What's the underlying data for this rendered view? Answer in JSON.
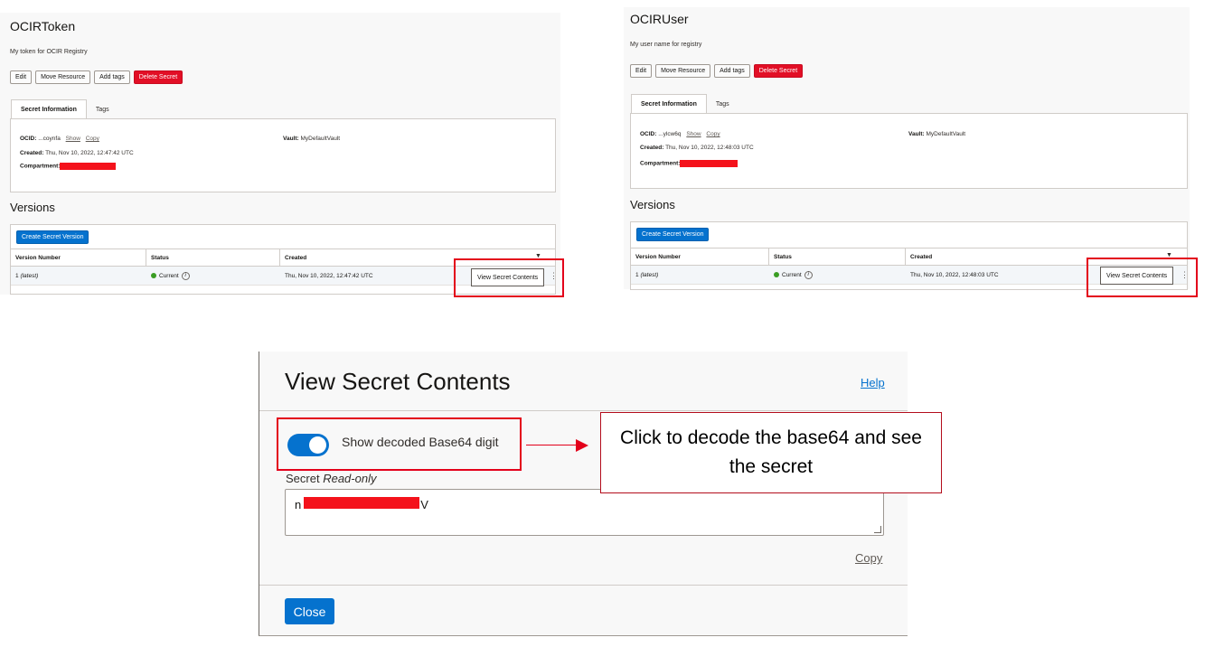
{
  "left_panel": {
    "title": "OCIRToken",
    "description": "My token for OCIR Registry",
    "buttons": {
      "edit": "Edit",
      "move": "Move Resource",
      "tags": "Add tags",
      "delete": "Delete Secret"
    },
    "tabs": {
      "info": "Secret Information",
      "tags": "Tags"
    },
    "ocid_label": "OCID:",
    "ocid_value": "...coynfa",
    "show_link": "Show",
    "copy_link": "Copy",
    "created_label": "Created:",
    "created_value": "Thu, Nov 10, 2022, 12:47:42 UTC",
    "compartment_label": "Compartment:",
    "vault_label": "Vault:",
    "vault_value": "MyDefaultVault",
    "versions_title": "Versions",
    "create_version_button": "Create Secret Version",
    "columns": {
      "version": "Version Number",
      "status": "Status",
      "created": "Created"
    },
    "row": {
      "version_num": "1",
      "version_tag": "(latest)",
      "status": "Current",
      "created": "Thu, Nov 10, 2022, 12:47:42 UTC"
    },
    "view_button": "View Secret Contents"
  },
  "right_panel": {
    "title": "OCIRUser",
    "description": "My user name for registry",
    "buttons": {
      "edit": "Edit",
      "move": "Move Resource",
      "tags": "Add tags",
      "delete": "Delete Secret"
    },
    "tabs": {
      "info": "Secret Information",
      "tags": "Tags"
    },
    "ocid_label": "OCID:",
    "ocid_value": "...ylcw6q",
    "show_link": "Show",
    "copy_link": "Copy",
    "created_label": "Created:",
    "created_value": "Thu, Nov 10, 2022, 12:48:03 UTC",
    "compartment_label": "Compartment:",
    "vault_label": "Vault:",
    "vault_value": "MyDefaultVault",
    "versions_title": "Versions",
    "create_version_button": "Create Secret Version",
    "columns": {
      "version": "Version Number",
      "status": "Status",
      "created": "Created"
    },
    "row": {
      "version_num": "1",
      "version_tag": "(latest)",
      "status": "Current",
      "created": "Thu, Nov 10, 2022, 12:48:03 UTC"
    },
    "view_button": "View Secret Contents"
  },
  "modal": {
    "title": "View Secret Contents",
    "help_link": "Help",
    "toggle_label": "Show decoded Base64 digit",
    "toggle_on": true,
    "secret_label": "Secret",
    "secret_readonly": "Read-only",
    "secret_visible_start": "n",
    "secret_visible_end": "V",
    "copy_link": "Copy",
    "close_button": "Close"
  },
  "callout": {
    "text": "Click to decode the base64 and see the secret"
  },
  "colors": {
    "accent_blue": "#0572ce",
    "danger_red": "#e20f26",
    "annotation_red": "#e3001b",
    "status_green": "#3a9d23"
  }
}
